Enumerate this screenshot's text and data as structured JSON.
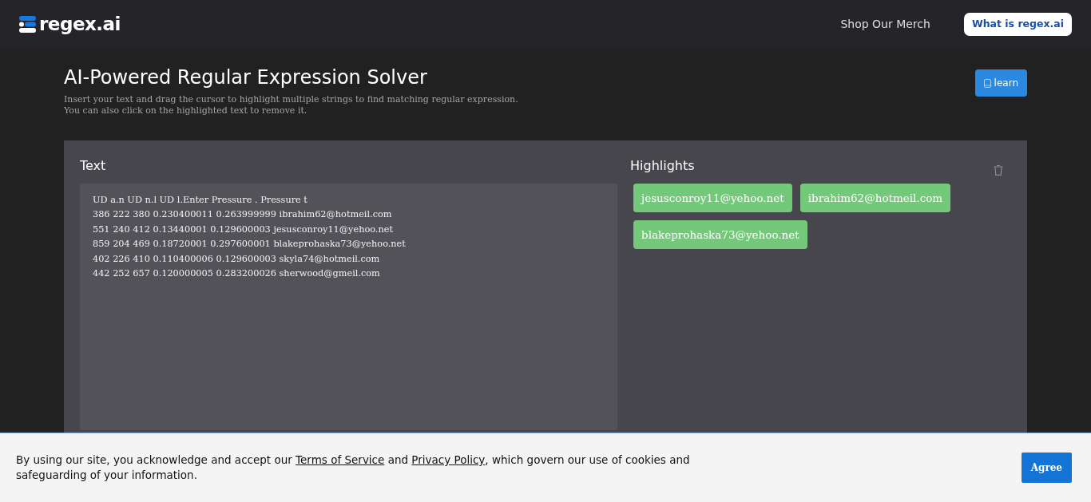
{
  "navbar": {
    "logo_text": "regex.ai",
    "links": [
      {
        "label": "Shop Our Merch",
        "kind": "plain"
      },
      {
        "label": "What is regex.ai",
        "kind": "pill"
      }
    ]
  },
  "header": {
    "title": "AI-Powered Regular Expression Solver",
    "subtitle_lines": [
      "Insert your text and drag the cursor to highlight multiple strings to find matching regular expression.",
      "You can also click on the highlighted text to remove it."
    ],
    "learn_button": "learn"
  },
  "text_panel": {
    "title": "Text",
    "value": "UD a.n UD n.l UD l.Enter Pressure . Pressure t\n386 222 380 0.230400011 0.263999999 ibrahim62@hotmeil.com\n551 240 412 0.13440001 0.129600003 jesusconroy11@yehoo.net\n859 204 469 0.18720001 0.297600001 blakeprohaska73@yehoo.net\n402 226 410 0.110400006 0.129600003 skyla74@hotmeil.com\n442 252 657 0.120000005 0.283200026 sherwood@gmeil.com"
  },
  "highlights_panel": {
    "title": "Highlights",
    "items": [
      {
        "text": "jesusconroy11@yehoo.net",
        "color": "#74c87a"
      },
      {
        "text": "ibrahim62@hotmeil.com",
        "color": "#74c87a"
      },
      {
        "text": "blakeprohaska73@yehoo.net",
        "color": "#74c87a"
      }
    ]
  },
  "cookie_banner": {
    "parts": [
      {
        "kind": "text",
        "text": "By using our site, you acknowledge and accept our "
      },
      {
        "kind": "link",
        "text": "Terms of Service"
      },
      {
        "kind": "text",
        "text": " and "
      },
      {
        "kind": "link",
        "text": "Privacy Policy"
      },
      {
        "kind": "text",
        "text": ", which govern our use of cookies and safeguarding of your information."
      }
    ],
    "button": "Agree"
  }
}
